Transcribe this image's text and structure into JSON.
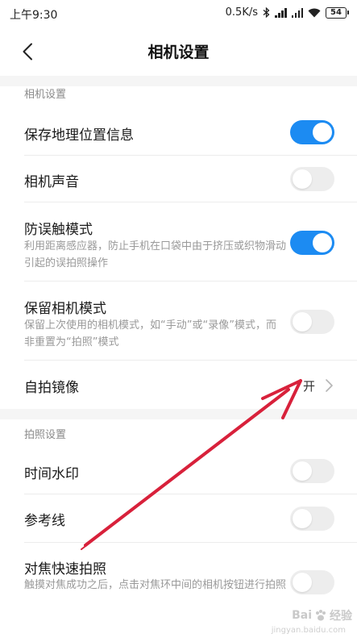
{
  "status_bar": {
    "time": "上午9:30",
    "speed": "0.5K/s",
    "battery": "54",
    "icons": [
      "bluetooth-icon",
      "signal-icon",
      "signal-icon",
      "wifi-icon",
      "battery-icon"
    ]
  },
  "header": {
    "back_icon": "chevron-left-icon",
    "title": "相机设置"
  },
  "sections": [
    {
      "header": "相机设置",
      "items": [
        {
          "title": "保存地理位置信息",
          "control": "toggle",
          "state": "on"
        },
        {
          "title": "相机声音",
          "control": "toggle",
          "state": "off"
        },
        {
          "title": "防误触模式",
          "desc": "利用距离感应器，防止手机在口袋中由于挤压或织物滑动引起的误拍照操作",
          "control": "toggle",
          "state": "on"
        },
        {
          "title": "保留相机模式",
          "desc": "保留上次使用的相机模式，如“手动”或“录像”模式，而非重置为“拍照”模式",
          "control": "toggle",
          "state": "off"
        },
        {
          "title": "自拍镜像",
          "control": "value",
          "value": "开"
        }
      ]
    },
    {
      "header": "拍照设置",
      "items": [
        {
          "title": "时间水印",
          "control": "toggle",
          "state": "off"
        },
        {
          "title": "参考线",
          "control": "toggle",
          "state": "off"
        },
        {
          "title": "对焦快速拍照",
          "desc": "触摸对焦成功之后，点击对焦环中间的相机按钮进行拍照",
          "control": "toggle",
          "state": "off"
        }
      ]
    }
  ],
  "colors": {
    "accent": "#1c8bf2",
    "toggle_off": "#ededed",
    "annotation_arrow": "#d8213b"
  },
  "watermark": {
    "brand": "Bai",
    "brand_suffix": "经验",
    "url": "jingyan.baidu.com"
  }
}
